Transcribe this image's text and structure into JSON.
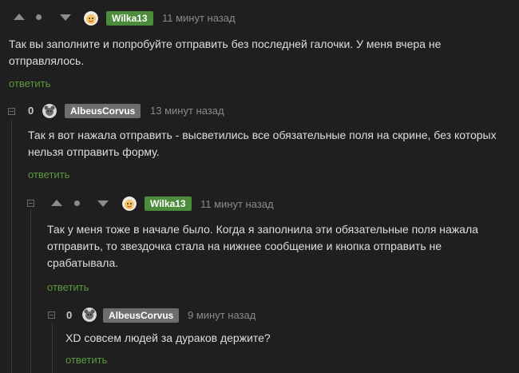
{
  "comments": [
    {
      "author": "Wilka13",
      "time": "11 минут назад",
      "text": "Так вы заполните и попробуйте отправить без последней галочки. У меня вчера не отправлялось.",
      "reply_label": "ответить"
    },
    {
      "score": "0",
      "author": "AlbeusCorvus",
      "time": "13 минут назад",
      "text": "Так я вот нажала отправить - высветились все обязательные поля на скрине, без которых нельзя отправить форму.",
      "reply_label": "ответить"
    },
    {
      "author": "Wilka13",
      "time": "11 минут назад",
      "text": "Так у меня тоже в начале было. Когда я заполнила эти обязательные поля нажала отправить, то звездочка стала на нижнее сообщение и кнопка отправить не срабатывала.",
      "reply_label": "ответить"
    },
    {
      "score": "0",
      "author": "AlbeusCorvus",
      "time": "9 минут назад",
      "text": "XD совсем людей за дураков держите?",
      "reply_label": "ответить"
    }
  ],
  "colors": {
    "background": "#1f1f1f",
    "author_badge_op": "#4c8c3a",
    "author_badge_other": "#6d6d6d",
    "reply_link": "#5a9a3e"
  },
  "icons": [
    "vote-up-icon",
    "vote-dot-icon",
    "vote-down-icon",
    "collapse-icon",
    "avatar-bear-icon",
    "avatar-face-icon"
  ]
}
